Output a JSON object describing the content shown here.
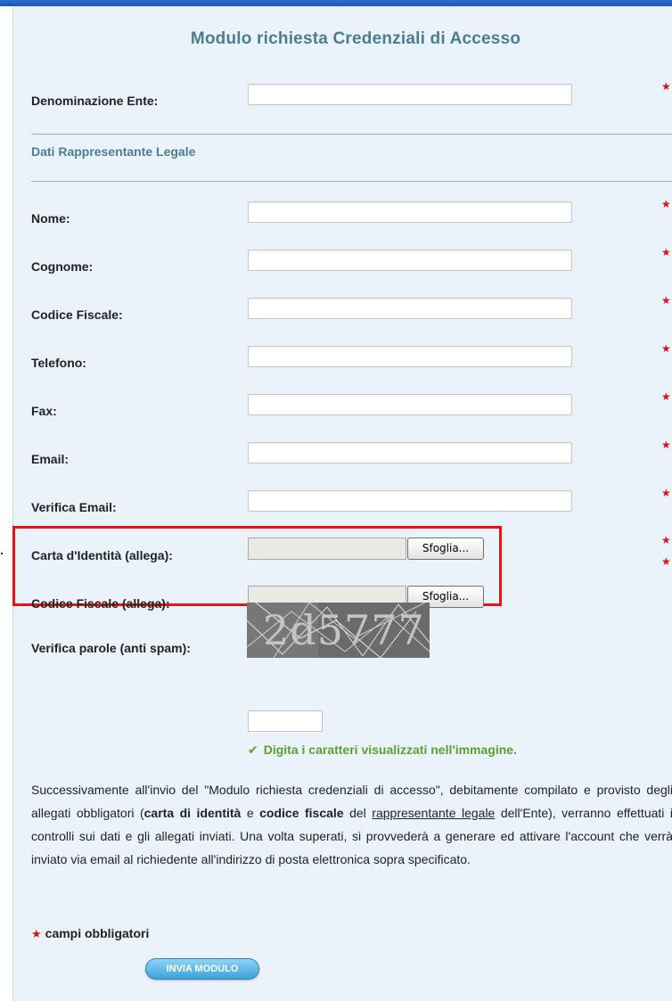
{
  "form": {
    "title": "Modulo richiesta Credenziali di Accesso",
    "ente_label": "Denominazione Ente:",
    "section_title": "Dati Rappresentante Legale",
    "fields": {
      "nome": "Nome:",
      "cognome": "Cognome:",
      "codice_fiscale": "Codice Fiscale:",
      "telefono": "Telefono:",
      "fax": "Fax:",
      "email": "Email:",
      "verifica_email": "Verifica Email:"
    },
    "attachments": {
      "carta_label": "Carta d'Identità (allega):",
      "cf_label": "Codice Fiscale (allega):",
      "browse_label": "Sfoglia..."
    },
    "captcha": {
      "label": "Verifica parole (anti spam):",
      "image_text": "2d5777",
      "hint": "Digita i caratteri visualizzati nell'immagine."
    },
    "paragraph": {
      "p1": "Successivamente all'invio del \"Modulo richiesta credenziali di accesso\", debitamente compilato e provisto degli allegati obbligatori (",
      "b1": "carta di identità",
      "p2": " e ",
      "b2": "codice fiscale",
      "p3": " del ",
      "u1": "rappresentante legale",
      "p4": " dell'Ente), verranno effettuati i controlli sui dati e gli allegati inviati. Una volta superati, si provvederà a generare ed attivare l'account che verrà inviato via email al richiedente all'indirizzo di posta elettronica sopra specificato."
    },
    "required_note": "campi obbligatori",
    "required_star": "★",
    "check_icon": "✔",
    "submit_label": "INVIA MODULO"
  },
  "colors": {
    "panel_bg": "#eaf3fa",
    "title": "#4d7c95",
    "required": "#dd1111",
    "hint": "#5ea02f",
    "highlight_box": "#ee1111"
  }
}
